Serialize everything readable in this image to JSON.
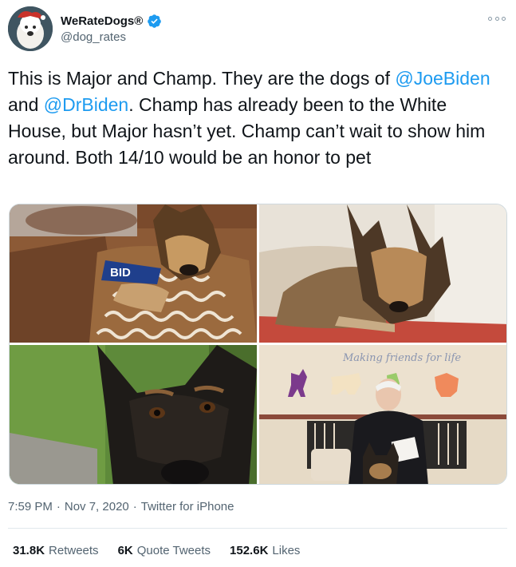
{
  "account": {
    "display_name": "WeRateDogs®",
    "handle": "@dog_rates"
  },
  "tweet": {
    "part1": "This is Major and Champ. They are the dogs of ",
    "mention1": "@JoeBiden",
    "part2": " and ",
    "mention2": "@DrBiden",
    "part3": ". Champ has already been to the White House, but Major hasn’t yet. Champ can’t wait to show him around. Both 14/10 would be an honor to pet"
  },
  "media": {
    "photo4_caption": "Making friends for life",
    "photo1_sign": "BID"
  },
  "meta": {
    "time": "7:59 PM",
    "sep1": "·",
    "date": "Nov 7, 2020",
    "sep2": "·",
    "source": "Twitter for iPhone"
  },
  "stats": {
    "retweets_count": "31.8K",
    "retweets_label": "Retweets",
    "quotes_count": "6K",
    "quotes_label": "Quote Tweets",
    "likes_count": "152.6K",
    "likes_label": "Likes"
  },
  "colors": {
    "link": "#1d9bf0",
    "verified": "#1d9bf0",
    "secondary_text": "#536471"
  },
  "icons": [
    "verified-badge-icon",
    "more-options-icon"
  ]
}
